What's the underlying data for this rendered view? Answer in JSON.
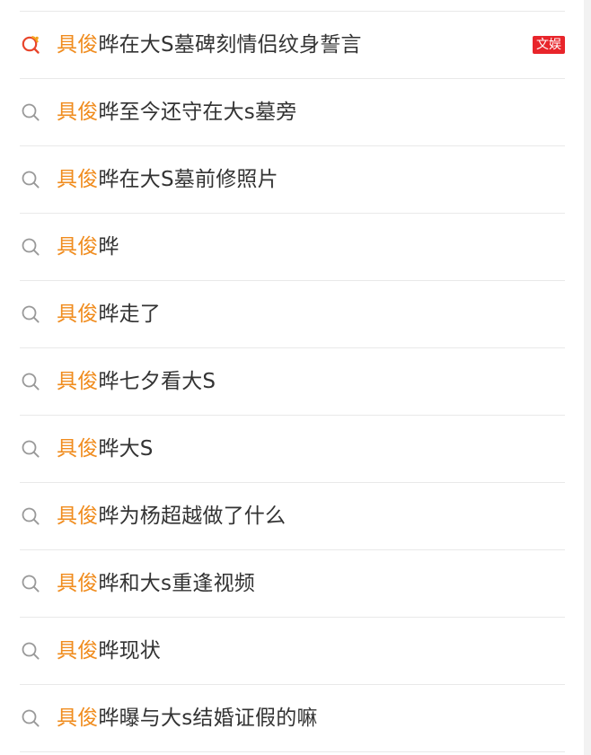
{
  "suggestions": [
    {
      "prefix": "具俊",
      "rest": "晔在大S墓碑刻情侣纹身誓言",
      "icon": "trending-search-icon",
      "tag": "文娱",
      "tag_color": "#e8252b"
    },
    {
      "prefix": "具俊",
      "rest": "晔至今还守在大s墓旁",
      "icon": "search-icon"
    },
    {
      "prefix": "具俊",
      "rest": "晔在大S墓前修照片",
      "icon": "search-icon"
    },
    {
      "prefix": "具俊",
      "rest": "晔",
      "icon": "search-icon"
    },
    {
      "prefix": "具俊",
      "rest": "晔走了",
      "icon": "search-icon"
    },
    {
      "prefix": "具俊",
      "rest": "晔七夕看大S",
      "icon": "search-icon"
    },
    {
      "prefix": "具俊",
      "rest": "晔大S",
      "icon": "search-icon"
    },
    {
      "prefix": "具俊",
      "rest": "晔为杨超越做了什么",
      "icon": "search-icon"
    },
    {
      "prefix": "具俊",
      "rest": "晔和大s重逢视频",
      "icon": "search-icon"
    },
    {
      "prefix": "具俊",
      "rest": "晔现状",
      "icon": "search-icon"
    },
    {
      "prefix": "具俊",
      "rest": "晔曝与大s结婚证假的嘛",
      "icon": "search-icon"
    }
  ],
  "colors": {
    "highlight": "#f08c1e",
    "text": "#333333",
    "divider": "#e9e9e9",
    "tag_bg": "#e8252b",
    "search_icon": "#999999",
    "trending_icon_ring": "#e8452b",
    "trending_icon_accent": "#f3a21d"
  }
}
